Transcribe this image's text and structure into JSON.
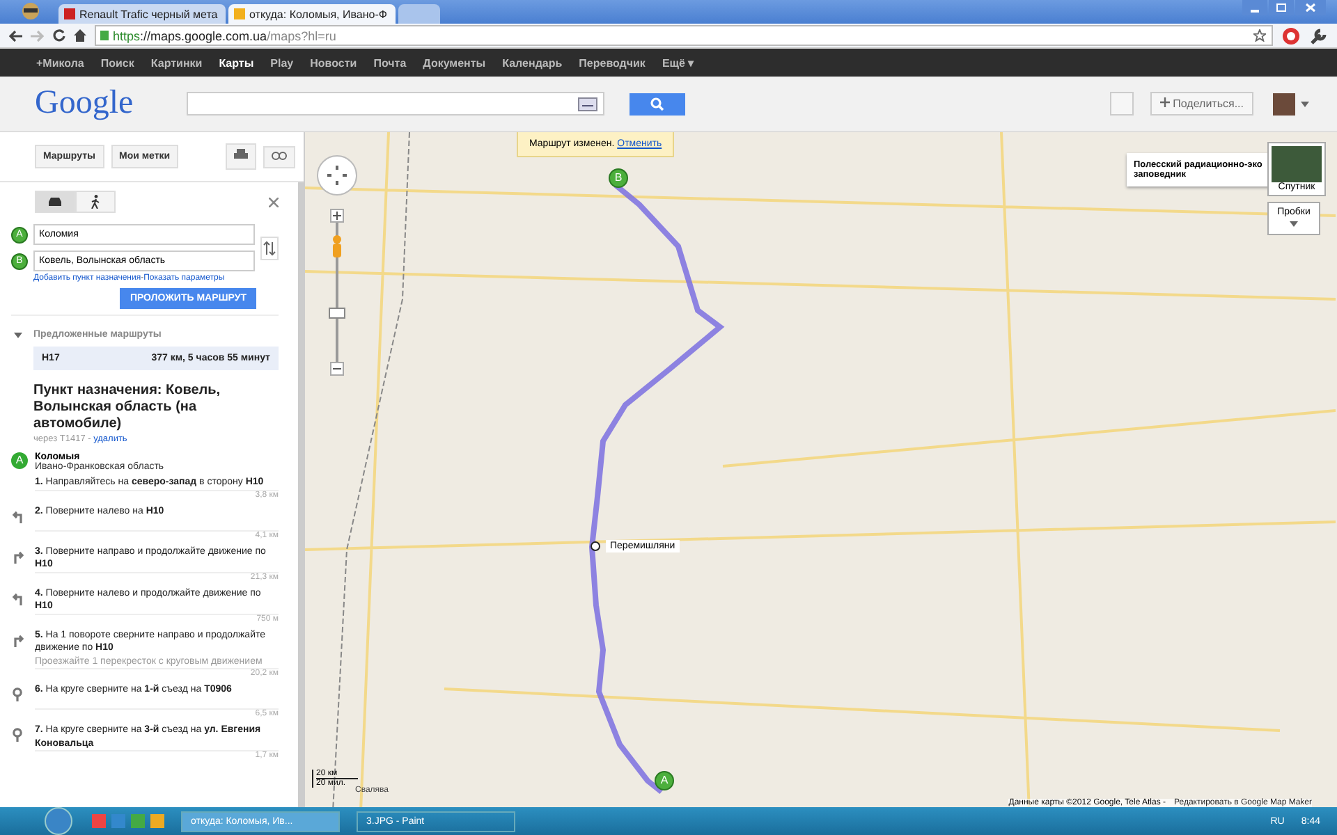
{
  "browser": {
    "tabs": [
      {
        "title": "Renault Trafic черный мета",
        "selected": false
      },
      {
        "title": "откуда: Коломыя, Ивано-Ф",
        "selected": true
      }
    ],
    "url": {
      "scheme": "https",
      "rest": "://maps.google.com.ua",
      "path": "/maps?hl=ru"
    }
  },
  "google_bar": {
    "items": [
      {
        "label": "+Микола",
        "selected": false
      },
      {
        "label": "Поиск",
        "selected": false
      },
      {
        "label": "Картинки",
        "selected": false
      },
      {
        "label": "Карты",
        "selected": true
      },
      {
        "label": "Play",
        "selected": false
      },
      {
        "label": "Новости",
        "selected": false
      },
      {
        "label": "Почта",
        "selected": false
      },
      {
        "label": "Документы",
        "selected": false
      },
      {
        "label": "Календарь",
        "selected": false
      },
      {
        "label": "Переводчик",
        "selected": false
      },
      {
        "label": "Ещё ▾",
        "selected": false
      }
    ]
  },
  "header": {
    "logo": "Google",
    "share": "Поделиться..."
  },
  "sidebar": {
    "tabs": [
      "Маршруты",
      "Мои метки"
    ],
    "mode": [
      {
        "kind": "car",
        "selected": true
      },
      {
        "kind": "walk",
        "selected": false
      }
    ],
    "waypoints": [
      {
        "letter": "A",
        "value": "Коломия"
      },
      {
        "letter": "B",
        "value": "Ковель, Волынская область"
      }
    ],
    "links": [
      "Добавить пункт назначения",
      "Показать параметры"
    ],
    "links_separator": "-",
    "submit": "ПРОЛОЖИТЬ МАРШРУТ",
    "suggested_title": "Предложенные маршруты",
    "route": {
      "name": "Н17",
      "summary": "377 км, 5 часов 55 минут"
    },
    "destination": {
      "title": "Пункт назначения: Ковель, Волынская область (на автомобиле)",
      "via": "через Т1417 -",
      "remove": "удалить"
    },
    "start": {
      "letter": "A",
      "name": "Коломыя",
      "region": "Ивано-Франковская область"
    },
    "steps": [
      {
        "kind": "start",
        "text": "**1.** Направляйтесь на **северо-запад** в сторону **Н10**",
        "distance": "3,8 км"
      },
      {
        "kind": "left",
        "text": "**2.** Поверните налево на **Н10**",
        "distance": "4,1 км"
      },
      {
        "kind": "right",
        "text": "**3.** Поверните направо и продолжайте движение по **Н10**",
        "distance": "21,3 км"
      },
      {
        "kind": "left",
        "text": "**4.** Поверните налево и продолжайте движение по **Н10**",
        "distance": "750 м"
      },
      {
        "kind": "right",
        "text": "**5.** На 1 повороте сверните направо и продолжайте движение по **Н10**",
        "note": "Проезжайте 1 перекресток с круговым движением",
        "distance": "20,2 км"
      },
      {
        "kind": "roundabout",
        "text": "**6.** На круге сверните на **1-й** съезд на **Т0906**",
        "distance": "6,5 км"
      },
      {
        "kind": "roundabout",
        "text": "**7.** На круге сверните на **3-й** съезд на **ул. Евгения Коновальца**",
        "distance": "1,7 км"
      }
    ]
  },
  "map": {
    "notice": {
      "text": "Маршрут изменен.",
      "action": "Отменить"
    },
    "markers": [
      {
        "letter": "B"
      },
      {
        "letter": "A"
      }
    ],
    "zoom": {
      "level": 0.35
    },
    "waypoint": "Перемишляни",
    "info": "Полесский радиационно-эко заповедник",
    "satellite": "Спутник",
    "traffic": "Пробки",
    "scale": [
      "20 км",
      "20 мил."
    ],
    "scale_note": "Свалява",
    "attribution": "Данные карты ©2012 Google, Tele Atlas -",
    "edit_link": "Редактировать в Google Map Maker"
  },
  "taskbar": {
    "tasks": [
      {
        "title": "откуда: Коломыя, Ив...",
        "selected": true
      },
      {
        "title": "3.JPG - Paint",
        "selected": false
      }
    ],
    "lang": "RU",
    "time": "8:44"
  }
}
